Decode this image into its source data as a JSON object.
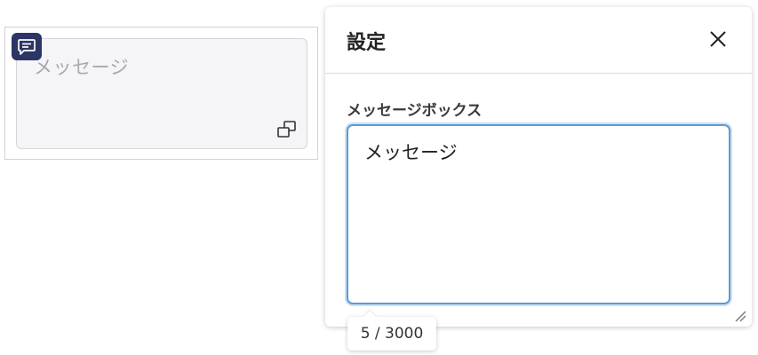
{
  "widget": {
    "placeholder": "メッセージ",
    "badge_icon": "message-icon",
    "expand_icon": "expand-icon",
    "badge_color": "#2c3566"
  },
  "settings": {
    "title": "設定",
    "close_icon": "close-icon",
    "field_label": "メッセージボックス",
    "field_value": "メッセージ",
    "focus_color": "#5b9bd5"
  },
  "counter": {
    "text": "5 / 3000"
  }
}
